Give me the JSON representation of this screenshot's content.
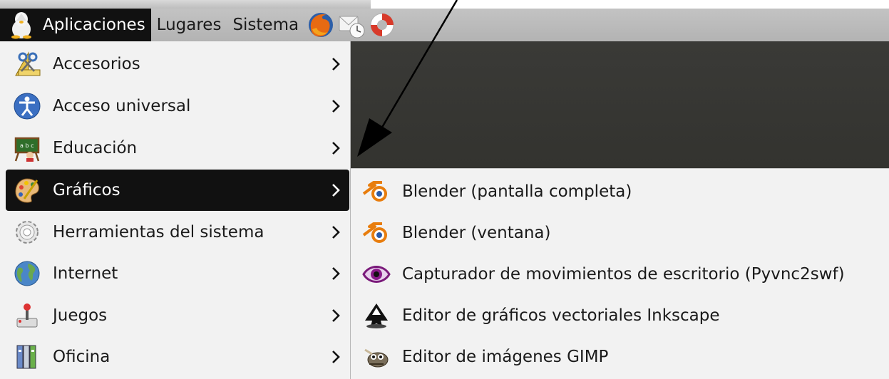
{
  "panel": {
    "menus": [
      {
        "label": "Aplicaciones",
        "icon": "distro-logo-icon"
      },
      {
        "label": "Lugares"
      },
      {
        "label": "Sistema"
      }
    ],
    "launchers": [
      "firefox-icon",
      "mail-clock-icon",
      "help-lifebuoy-icon"
    ]
  },
  "menu": {
    "items": [
      {
        "label": "Accesorios",
        "icon": "accessories-icon",
        "active": false
      },
      {
        "label": "Acceso universal",
        "icon": "accessibility-icon",
        "active": false
      },
      {
        "label": "Educación",
        "icon": "education-icon",
        "active": false
      },
      {
        "label": "Gráficos",
        "icon": "graphics-palette-icon",
        "active": true
      },
      {
        "label": "Herramientas del sistema",
        "icon": "system-tools-gear-icon",
        "active": false
      },
      {
        "label": "Internet",
        "icon": "globe-icon",
        "active": false
      },
      {
        "label": "Juegos",
        "icon": "games-joystick-icon",
        "active": false
      },
      {
        "label": "Oficina",
        "icon": "office-icon",
        "active": false
      }
    ]
  },
  "submenu": {
    "items": [
      {
        "label": "Blender (pantalla completa)",
        "icon": "blender-icon"
      },
      {
        "label": "Blender (ventana)",
        "icon": "blender-icon"
      },
      {
        "label": "Capturador de movimientos de escritorio (Pyvnc2swf)",
        "icon": "eye-capture-icon"
      },
      {
        "label": "Editor de gráficos vectoriales Inkscape",
        "icon": "inkscape-icon"
      },
      {
        "label": "Editor de imágenes GIMP",
        "icon": "gimp-icon"
      }
    ]
  },
  "colors": {
    "active_bg": "#111111",
    "menu_bg": "#f2f2f2",
    "panel_bg": "#b8b8b8",
    "desktop_bg": "#363632",
    "blender_orange": "#e87d0d"
  }
}
